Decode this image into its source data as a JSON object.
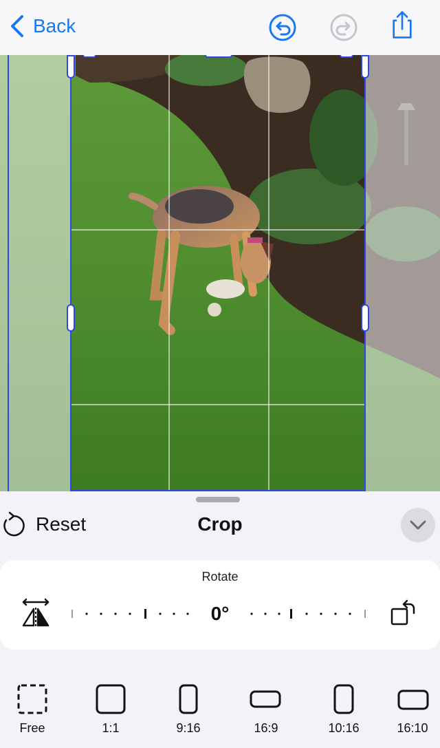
{
  "nav": {
    "back_label": "Back"
  },
  "sheet": {
    "reset_label": "Reset",
    "title": "Crop"
  },
  "rotate": {
    "label": "Rotate",
    "value": "0°"
  },
  "aspect_ratios": [
    {
      "label": "Free"
    },
    {
      "label": "1:1"
    },
    {
      "label": "9:16"
    },
    {
      "label": "16:9"
    },
    {
      "label": "10:16"
    },
    {
      "label": "16:10"
    }
  ],
  "colors": {
    "accent": "#1877f2",
    "crop_border": "#2d48e6"
  }
}
